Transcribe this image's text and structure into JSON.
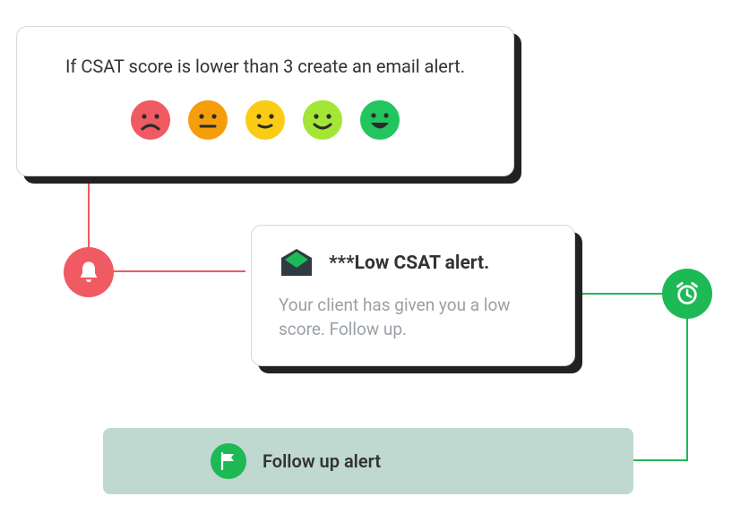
{
  "rule_card": {
    "text": "If CSAT score is lower than 3 create an email alert.",
    "faces": [
      "face-1-sad",
      "face-2-neutral",
      "face-3-mild",
      "face-4-happy",
      "face-5-very-happy"
    ]
  },
  "alert_card": {
    "title": "***Low CSAT alert.",
    "body": "Your client has given you a low score. Follow up."
  },
  "followup_card": {
    "title": "Follow up alert"
  },
  "colors": {
    "red": "#ef5a63",
    "green": "#1db954",
    "face1": "#ef5a63",
    "face2": "#f59e0b",
    "face3": "#facc15",
    "face4": "#a3e635",
    "face5": "#22c55e",
    "envelope_body": "#2f3a44",
    "envelope_flap": "#1db954",
    "followup_bg": "#bfd8d0"
  }
}
